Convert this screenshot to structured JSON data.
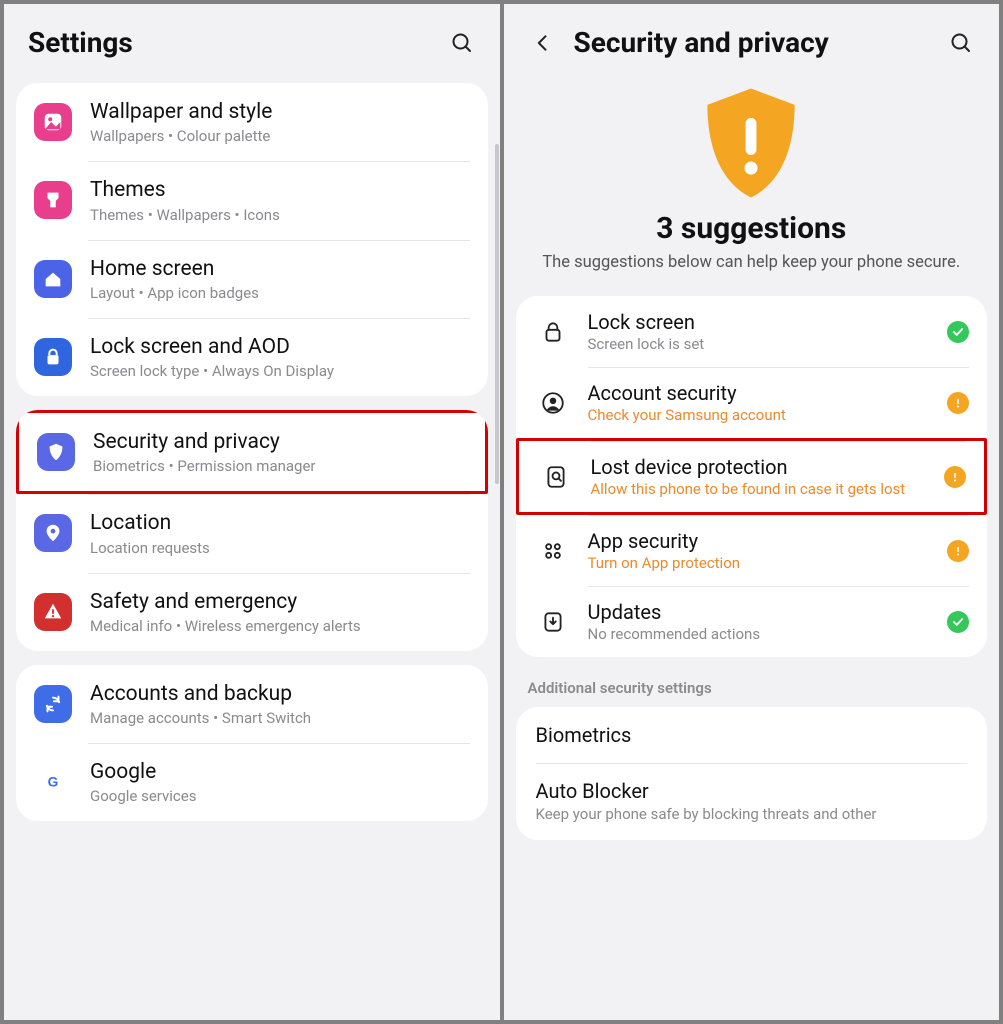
{
  "left": {
    "title": "Settings",
    "groups": [
      {
        "items": [
          {
            "icon": "wallpaper",
            "color": "#e83e8c",
            "title": "Wallpaper and style",
            "sub": "Wallpapers  •  Colour palette"
          },
          {
            "icon": "themes",
            "color": "#e83e8c",
            "title": "Themes",
            "sub": "Themes  •  Wallpapers  •  Icons"
          },
          {
            "icon": "home",
            "color": "#4b63e6",
            "title": "Home screen",
            "sub": "Layout  •  App icon badges"
          },
          {
            "icon": "lock",
            "color": "#2f66e0",
            "title": "Lock screen and AOD",
            "sub": "Screen lock type  •  Always On Display"
          }
        ]
      },
      {
        "items": [
          {
            "icon": "shield",
            "color": "#5a68e6",
            "title": "Security and privacy",
            "sub": "Biometrics  •  Permission manager",
            "highlight": true
          },
          {
            "icon": "location",
            "color": "#5a68e6",
            "title": "Location",
            "sub": "Location requests"
          },
          {
            "icon": "emergency",
            "color": "#d22f2f",
            "title": "Safety and emergency",
            "sub": "Medical info  •  Wireless emergency alerts"
          }
        ]
      },
      {
        "items": [
          {
            "icon": "sync",
            "color": "#3f6de8",
            "title": "Accounts and backup",
            "sub": "Manage accounts  •  Smart Switch"
          },
          {
            "icon": "google",
            "color": "#ffffff",
            "title": "Google",
            "sub": "Google services"
          }
        ]
      }
    ]
  },
  "right": {
    "title": "Security and privacy",
    "hero_title": "3 suggestions",
    "hero_sub": "The suggestions below can help keep your phone secure.",
    "statuses": [
      {
        "icon": "padlock",
        "title": "Lock screen",
        "sub": "Screen lock is set",
        "subcolor": "gray",
        "dot": "green"
      },
      {
        "icon": "account",
        "title": "Account security",
        "sub": "Check your Samsung account",
        "subcolor": "orange",
        "dot": "orange"
      },
      {
        "icon": "find",
        "title": "Lost device protection",
        "sub": "Allow this phone to be found in case it gets lost",
        "subcolor": "orange",
        "dot": "orange",
        "highlight": true
      },
      {
        "icon": "apps",
        "title": "App security",
        "sub": "Turn on App protection",
        "subcolor": "orange",
        "dot": "orange"
      },
      {
        "icon": "updates",
        "title": "Updates",
        "sub": "No recommended actions",
        "subcolor": "gray",
        "dot": "green"
      }
    ],
    "section_label": "Additional security settings",
    "extras": [
      {
        "title": "Biometrics",
        "sub": ""
      },
      {
        "title": "Auto Blocker",
        "sub": "Keep your phone safe by blocking threats and other"
      }
    ]
  }
}
